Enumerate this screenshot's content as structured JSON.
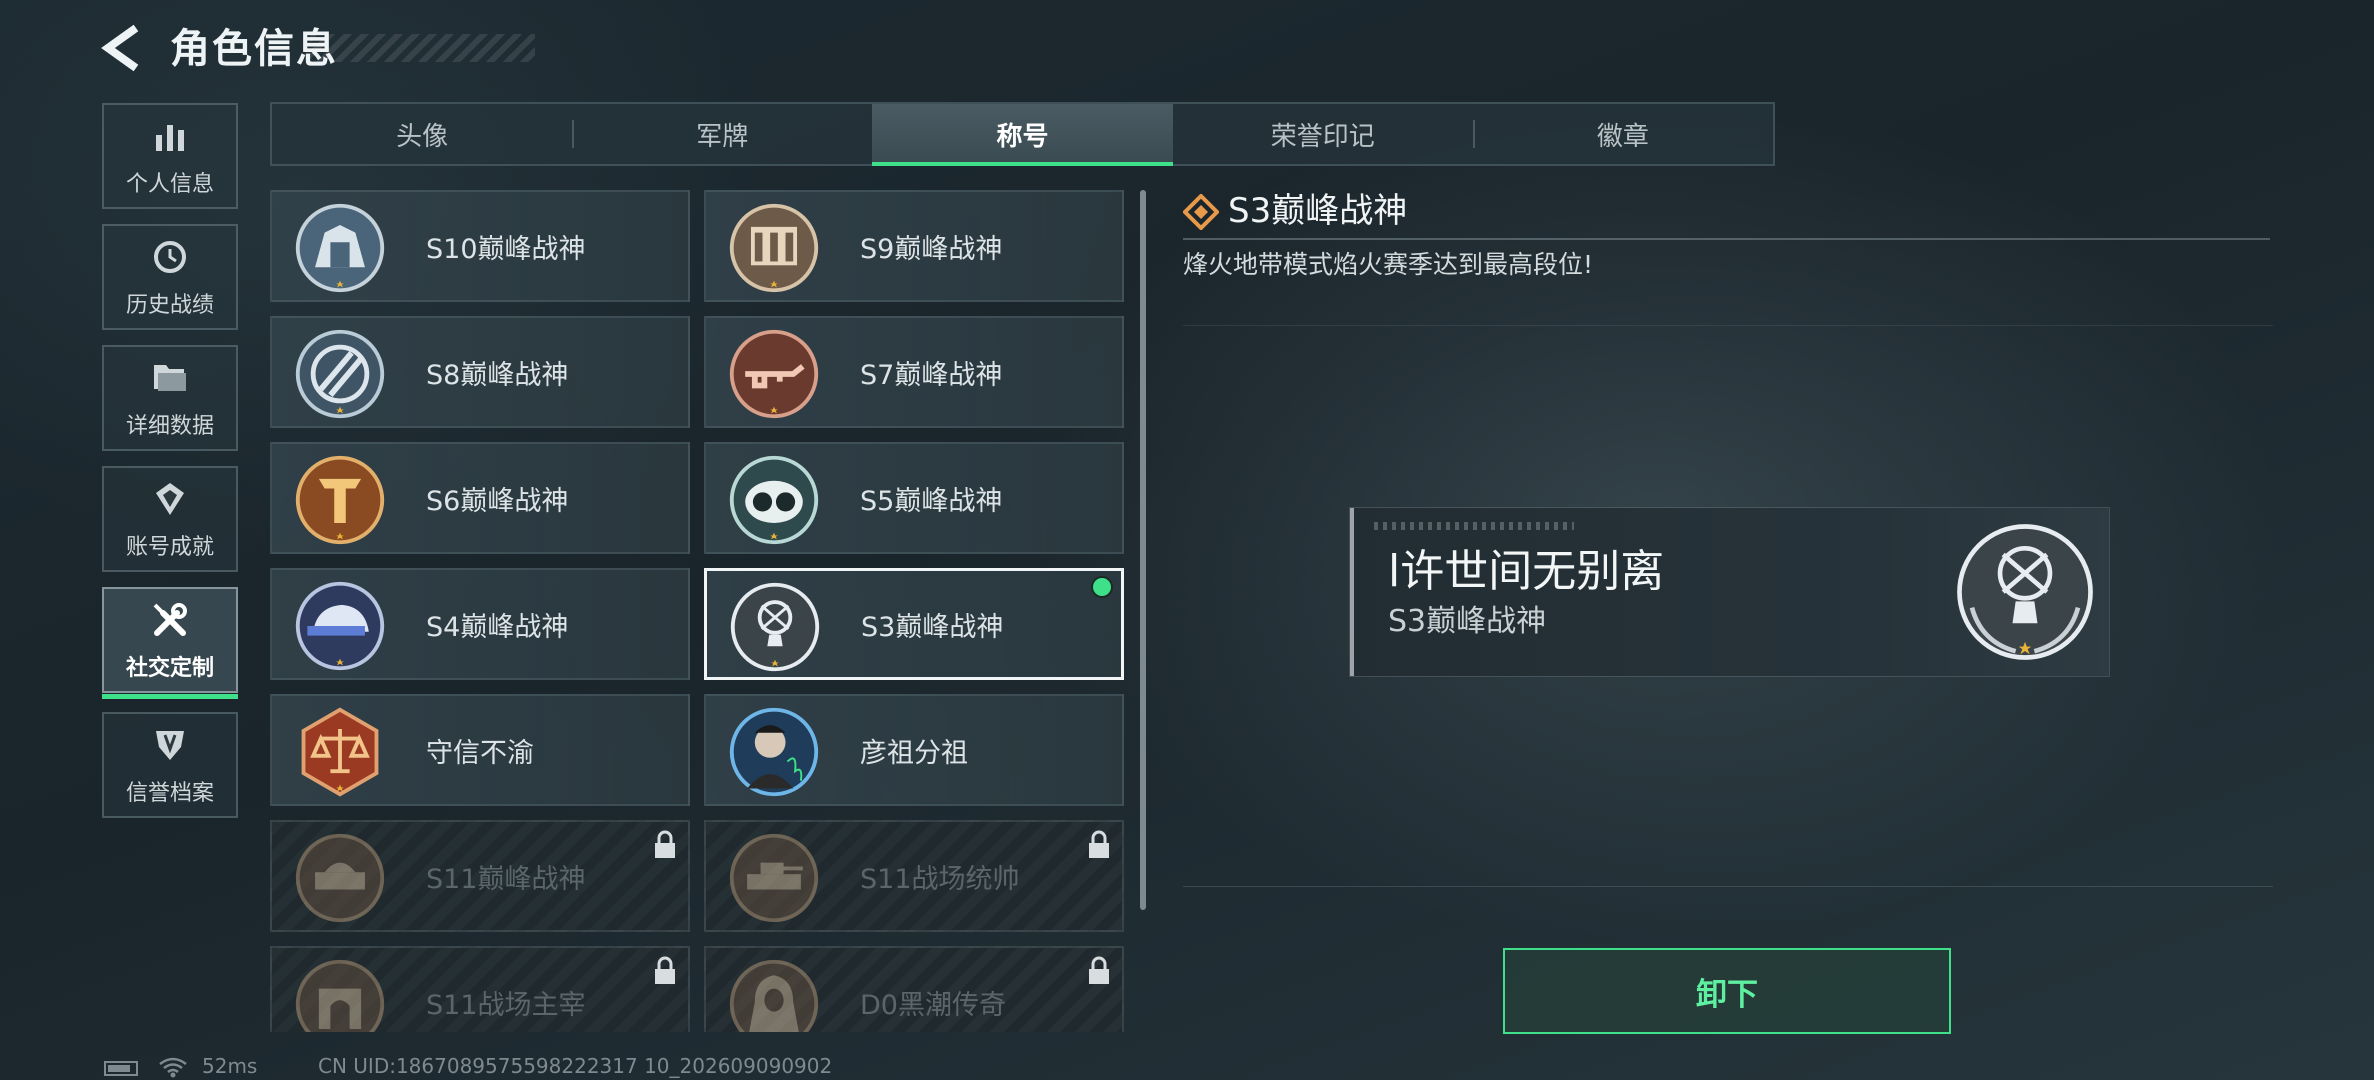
{
  "header": {
    "title": "角色信息"
  },
  "sidebar": {
    "items": [
      {
        "label": "个人信息",
        "icon": "bar-chart-icon",
        "active": false
      },
      {
        "label": "历史战绩",
        "icon": "history-clock-icon",
        "active": false
      },
      {
        "label": "详细数据",
        "icon": "folder-icon",
        "active": false
      },
      {
        "label": "账号成就",
        "icon": "achievement-icon",
        "active": false
      },
      {
        "label": "社交定制",
        "icon": "tools-icon",
        "active": true
      },
      {
        "label": "信誉档案",
        "icon": "shield-icon",
        "active": false
      }
    ]
  },
  "tabs": [
    {
      "label": "头像",
      "active": false
    },
    {
      "label": "军牌",
      "active": false
    },
    {
      "label": "称号",
      "active": true
    },
    {
      "label": "荣誉印记",
      "active": false
    },
    {
      "label": "徽章",
      "active": false
    }
  ],
  "titles": [
    {
      "name": "S10巅峰战神",
      "locked": false,
      "selected": false,
      "equipped": false
    },
    {
      "name": "S9巅峰战神",
      "locked": false,
      "selected": false,
      "equipped": false
    },
    {
      "name": "S8巅峰战神",
      "locked": false,
      "selected": false,
      "equipped": false
    },
    {
      "name": "S7巅峰战神",
      "locked": false,
      "selected": false,
      "equipped": false
    },
    {
      "name": "S6巅峰战神",
      "locked": false,
      "selected": false,
      "equipped": false
    },
    {
      "name": "S5巅峰战神",
      "locked": false,
      "selected": false,
      "equipped": false
    },
    {
      "name": "S4巅峰战神",
      "locked": false,
      "selected": false,
      "equipped": false
    },
    {
      "name": "S3巅峰战神",
      "locked": false,
      "selected": true,
      "equipped": true
    },
    {
      "name": "守信不渝",
      "locked": false,
      "selected": false,
      "equipped": false
    },
    {
      "name": "彦祖分祖",
      "locked": false,
      "selected": false,
      "equipped": false
    },
    {
      "name": "S11巅峰战神",
      "locked": true,
      "selected": false,
      "equipped": false
    },
    {
      "name": "S11战场统帅",
      "locked": true,
      "selected": false,
      "equipped": false
    },
    {
      "name": "S11战场主宰",
      "locked": true,
      "selected": false,
      "equipped": false
    },
    {
      "name": "D0黑潮传奇",
      "locked": true,
      "selected": false,
      "equipped": false
    }
  ],
  "detail": {
    "title": "S3巅峰战神",
    "description": "烽火地带模式焰火赛季达到最高段位!",
    "plate": {
      "player_name": "l许世间无别离",
      "title": "S3巅峰战神"
    },
    "unequip_label": "卸下"
  },
  "status_bar": {
    "ping": "52ms",
    "uid": "CN UID:1867089575598222317 10_202609090902"
  },
  "colors": {
    "accent": "#3ee08a",
    "background": "#1d2a31",
    "selected_border": "#f2f5f6"
  }
}
